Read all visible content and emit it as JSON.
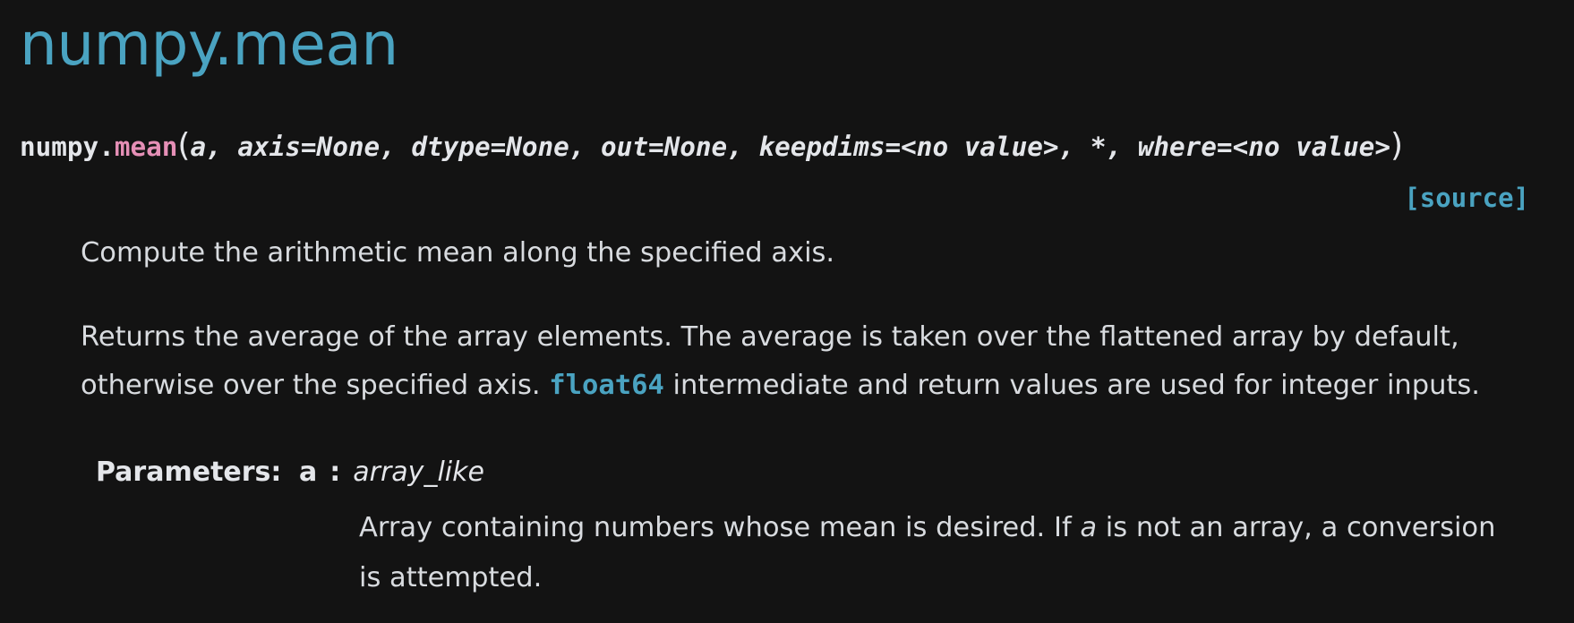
{
  "title": "numpy.mean",
  "signature": {
    "module": "numpy.",
    "name": "mean",
    "open_paren": "(",
    "params": "a, axis=None, dtype=None, out=None, keepdims=<no value>, *, where=<no value>",
    "close_paren": ")"
  },
  "source_link": "[source]",
  "summary": "Compute the arithmetic mean along the specified axis.",
  "description": {
    "line1": "Returns the average of the array elements. The average is taken over the flattened array by default,",
    "line2_before": "otherwise over the specified axis. ",
    "line2_code": "float64",
    "line2_after": " intermediate and return values are used for integer inputs."
  },
  "parameters": {
    "label": "Parameters:",
    "items": [
      {
        "name": "a",
        "colon": ":",
        "type": "array_like",
        "desc_line1_before": "Array containing numbers whose mean is desired. If ",
        "desc_line1_em": "a",
        "desc_line1_after": " is not an array, a conversion",
        "desc_line2": "is attempted."
      }
    ]
  },
  "colors": {
    "background": "#131313",
    "accent": "#4aa3c1",
    "function_name": "#e58fb6",
    "text": "#d8dbdf"
  }
}
